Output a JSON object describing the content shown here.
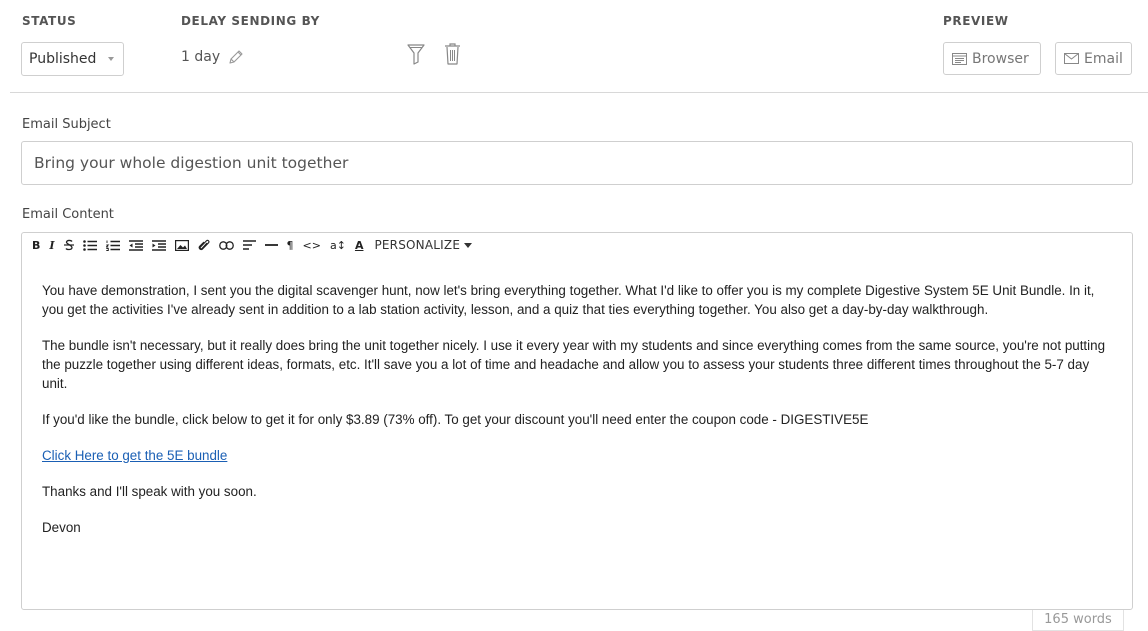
{
  "header": {
    "status_label": "STATUS",
    "delay_label": "DELAY SENDING BY",
    "preview_label": "PREVIEW",
    "status_value": "Published",
    "delay_value": "1 day",
    "preview_browser": "Browser",
    "preview_email": "Email"
  },
  "subject": {
    "label": "Email Subject",
    "value": "Bring your whole digestion unit together"
  },
  "content": {
    "label": "Email Content",
    "toolbar": {
      "bold": "B",
      "italic": "I",
      "paragraph": "¶",
      "code": "<>",
      "font_size": "a↕",
      "text_color": "A",
      "personalize": "PERSONALIZE"
    },
    "paragraphs": [
      "You have demonstration, I sent you the digital scavenger hunt, now let's bring everything together. What I'd like to offer you is my complete Digestive System 5E Unit Bundle. In it, you get the activities I've already sent in addition to a lab station activity, lesson, and a quiz that ties everything together. You also get a day-by-day walkthrough.",
      "The bundle isn't necessary, but it really does bring the unit together nicely. I use it every year with my students and since everything comes from the same source, you're not putting the puzzle together using different ideas, formats, etc. It'll save you a lot of time and headache and allow you to assess your students three different times throughout the 5-7 day unit.",
      "If you'd like the bundle, click below to get it for only $3.89 (73% off). To get your discount you'll need enter the coupon code - DIGESTIVE5E"
    ],
    "link_text": "Click Here to get the 5E bundle",
    "closing": "Thanks and I'll speak with you soon.",
    "signature": "Devon"
  },
  "word_count": "165 words",
  "icons": [
    "pencil-icon",
    "filter-icon",
    "trash-icon",
    "browser-icon",
    "envelope-icon"
  ],
  "colors": {
    "link": "#1a5fb4",
    "border": "#cfcfcf",
    "label": "#555555"
  }
}
